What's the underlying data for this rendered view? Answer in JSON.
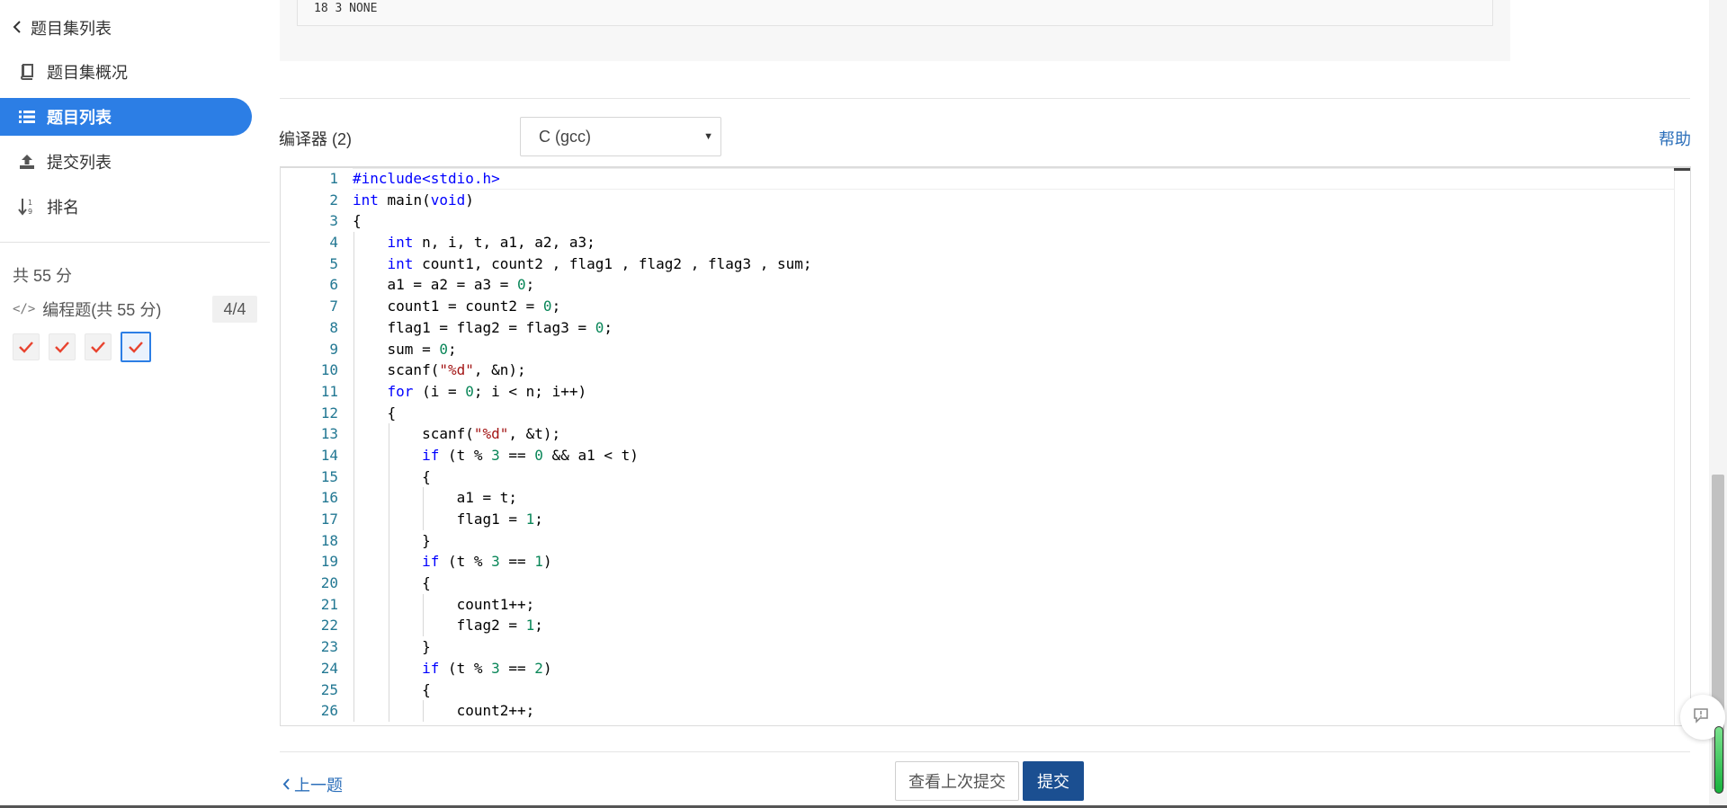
{
  "sidebar": {
    "back_label": "题目集列表",
    "items": [
      {
        "label": "题目集概况",
        "icon": "book-icon"
      },
      {
        "label": "题目列表",
        "icon": "list-icon",
        "active": true
      },
      {
        "label": "提交列表",
        "icon": "upload-icon"
      },
      {
        "label": "排名",
        "icon": "sort-numeric-icon"
      }
    ],
    "score_total": "共 55 分",
    "section": {
      "label": "编程题(共 55 分)",
      "progress": "4/4"
    },
    "problems": [
      {
        "status": "accepted"
      },
      {
        "status": "accepted"
      },
      {
        "status": "accepted"
      },
      {
        "status": "accepted",
        "current": true
      }
    ]
  },
  "sample_output": {
    "text": "18 3 NONE"
  },
  "compiler": {
    "label": "编译器 (2)",
    "selected": "C (gcc)",
    "help": "帮助"
  },
  "editor": {
    "line_numbers": [
      "1",
      "2",
      "3",
      "4",
      "5",
      "6",
      "7",
      "8",
      "9",
      "10",
      "11",
      "12",
      "13",
      "14",
      "15",
      "16",
      "17",
      "18",
      "19",
      "20",
      "21",
      "22",
      "23",
      "24",
      "25",
      "26"
    ],
    "lines": [
      "#include<stdio.h>",
      "int main(void)",
      "{",
      "    int n, i, t, a1, a2, a3;",
      "    int count1, count2 , flag1 , flag2 , flag3 , sum;",
      "    a1 = a2 = a3 = 0;",
      "    count1 = count2 = 0;",
      "    flag1 = flag2 = flag3 = 0;",
      "    sum = 0;",
      "    scanf(\"%d\", &n);",
      "    for (i = 0; i < n; i++)",
      "    {",
      "        scanf(\"%d\", &t);",
      "        if (t % 3 == 0 && a1 < t)",
      "        {",
      "            a1 = t;",
      "            flag1 = 1;",
      "        }",
      "        if (t % 3 == 1)",
      "        {",
      "            count1++;",
      "            flag2 = 1;",
      "        }",
      "        if (t % 3 == 2)",
      "        {",
      "            count2++;"
    ]
  },
  "footer": {
    "prev_label": "上一题",
    "history_label": "查看上次提交",
    "submit_label": "提交"
  },
  "colors": {
    "accent": "#2c7ee5",
    "submit": "#1b4f91",
    "check": "#e8432f",
    "link": "#2c6fba"
  }
}
